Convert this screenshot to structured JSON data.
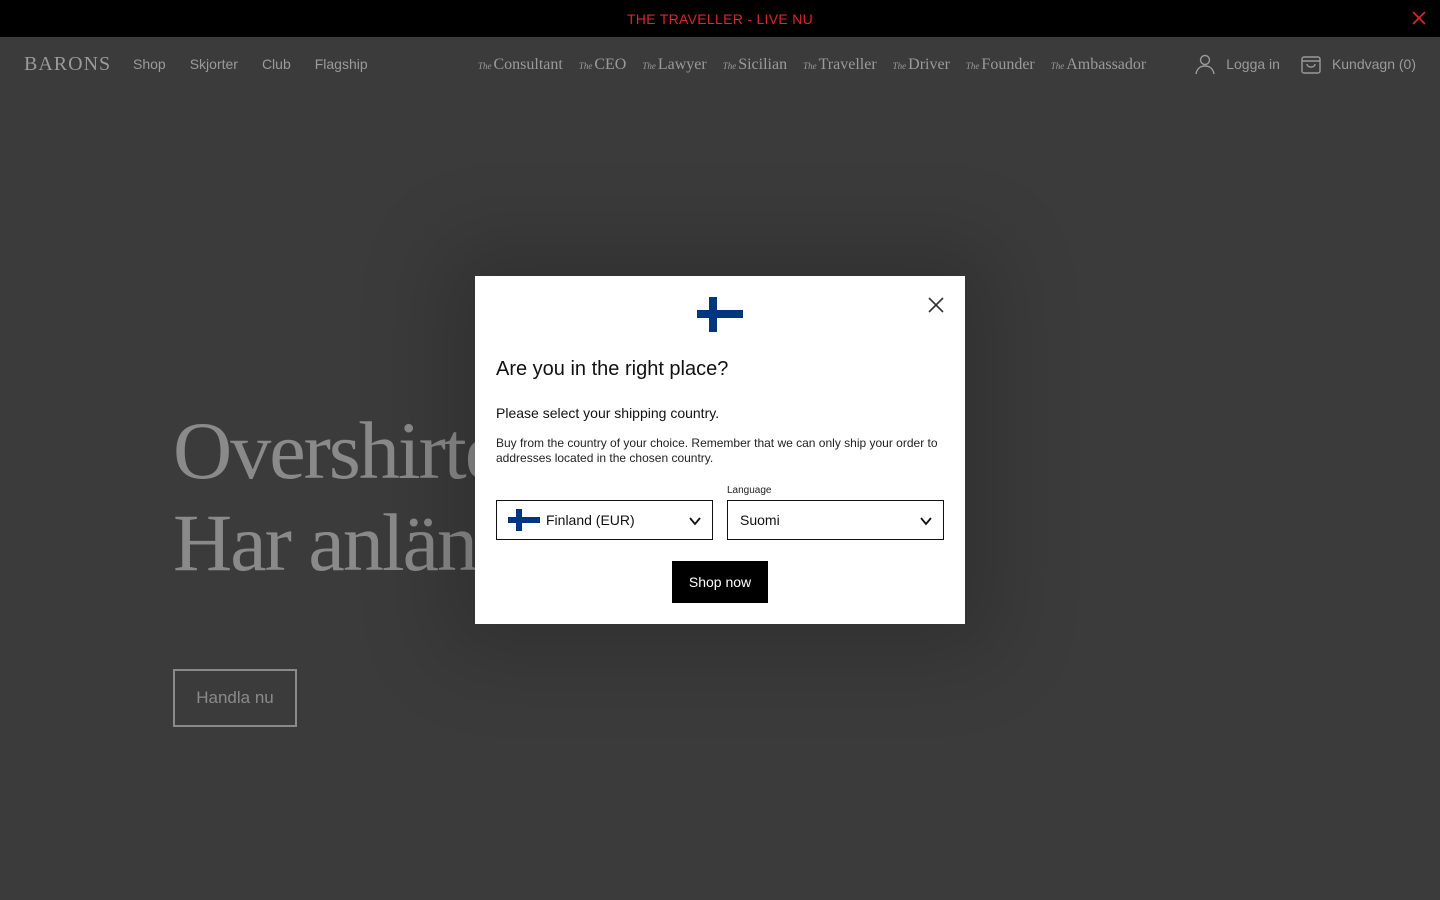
{
  "announcement": {
    "text": "THE TRAVELLER - LIVE NU",
    "color": "#d9272e"
  },
  "header": {
    "logo": "BARONS",
    "nav_left": [
      "Shop",
      "Skjorter",
      "Club",
      "Flagship"
    ],
    "personas": [
      {
        "prefix": "The",
        "name": "Consultant"
      },
      {
        "prefix": "The",
        "name": "CEO"
      },
      {
        "prefix": "The",
        "name": "Lawyer"
      },
      {
        "prefix": "The",
        "name": "Sicilian"
      },
      {
        "prefix": "The",
        "name": "Traveller"
      },
      {
        "prefix": "The",
        "name": "Driver"
      },
      {
        "prefix": "The",
        "name": "Founder"
      },
      {
        "prefix": "The",
        "name": "Ambassador"
      }
    ],
    "login": "Logga in",
    "cart": "Kundvagn (0)",
    "icons": {
      "login": "user-icon",
      "cart": "shopping-bag-icon"
    }
  },
  "hero": {
    "line1": "Overshirte",
    "line2": "Har anlänt",
    "cta": "Handla nu"
  },
  "modal": {
    "flag_icon": "finland-flag-icon",
    "title": "Are you in the right place?",
    "subtitle": "Please select your shipping country.",
    "body": "Buy from the country of your choice. Remember that we can only ship your order to addresses located in the chosen country.",
    "country_selected": "Finland (EUR)",
    "language_label": "Language",
    "language_selected": "Suomi",
    "cta": "Shop now",
    "flag_colors": {
      "white": "#ffffff",
      "blue": "#003580"
    }
  }
}
